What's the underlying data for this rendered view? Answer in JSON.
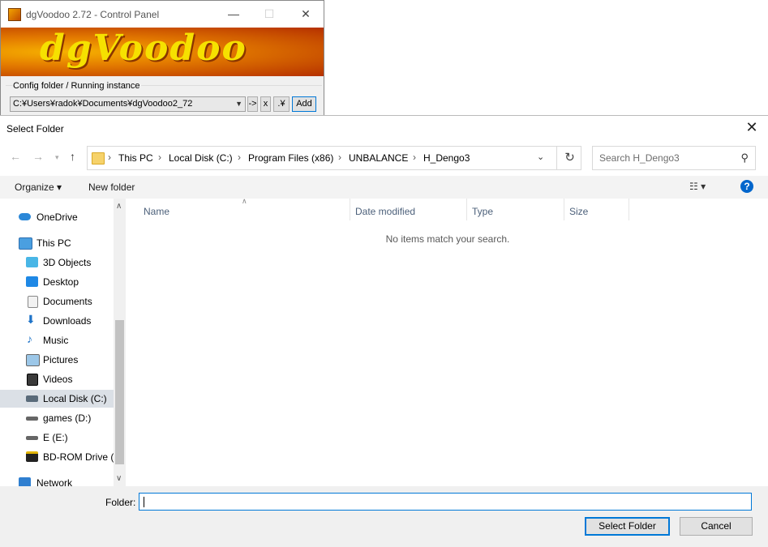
{
  "dgvoodoo": {
    "title": "dgVoodoo 2.72 - Control Panel",
    "logo_text": "dgVoodoo",
    "minimize": "—",
    "maximize": "☐",
    "close": "✕",
    "group_label": "Config folder / Running instance",
    "config_path": "C:¥Users¥radok¥Documents¥dgVoodoo2_72",
    "btn_arrow": "->",
    "btn_x": "x",
    "btn_dot": ".¥",
    "btn_add": "Add"
  },
  "dialog": {
    "title": "Select Folder",
    "close": "✕",
    "breadcrumbs": [
      "This PC",
      "Local Disk (C:)",
      "Program Files (x86)",
      "UNBALANCE",
      "H_Dengo3"
    ],
    "search_placeholder": "Search H_Dengo3",
    "toolbar": {
      "organize": "Organize ▾",
      "new_folder": "New folder"
    },
    "nav_items": [
      {
        "label": "OneDrive",
        "icon": "cloud-icon"
      },
      {
        "label": "This PC",
        "icon": "computer-icon"
      },
      {
        "label": "3D Objects",
        "icon": "cube-icon"
      },
      {
        "label": "Desktop",
        "icon": "desktop-icon"
      },
      {
        "label": "Documents",
        "icon": "document-icon"
      },
      {
        "label": "Downloads",
        "icon": "download-icon"
      },
      {
        "label": "Music",
        "icon": "music-icon"
      },
      {
        "label": "Pictures",
        "icon": "picture-icon"
      },
      {
        "label": "Videos",
        "icon": "video-icon"
      },
      {
        "label": "Local Disk (C:)",
        "icon": "drive-icon"
      },
      {
        "label": "games (D:)",
        "icon": "drive-icon"
      },
      {
        "label": "E (E:)",
        "icon": "drive-icon"
      },
      {
        "label": "BD-ROM Drive (I",
        "icon": "disc-drive-icon"
      },
      {
        "label": "Network",
        "icon": "network-icon"
      }
    ],
    "columns": [
      "Name",
      "Date modified",
      "Type",
      "Size"
    ],
    "empty_message": "No items match your search.",
    "folder_label": "Folder:",
    "folder_value": "",
    "select_button": "Select Folder",
    "cancel_button": "Cancel"
  },
  "colors": {
    "accent": "#0078d7",
    "selected_nav": "#dbe0e6",
    "column_text": "#4c607a"
  }
}
